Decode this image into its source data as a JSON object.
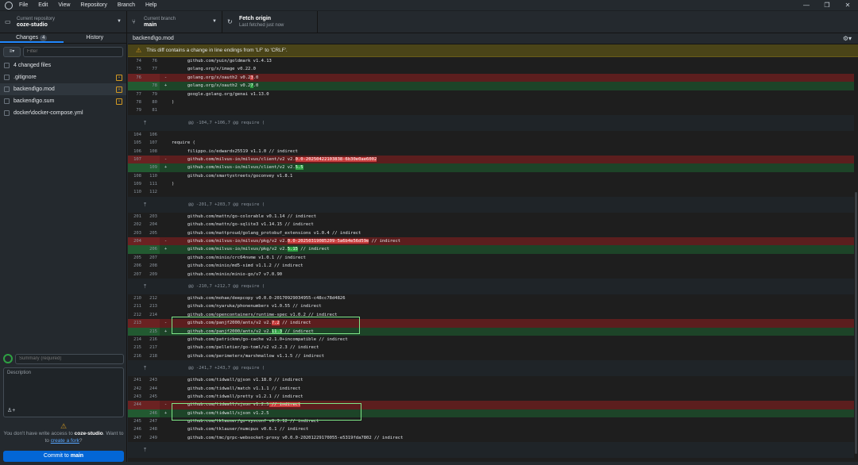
{
  "menu": [
    "File",
    "Edit",
    "View",
    "Repository",
    "Branch",
    "Help"
  ],
  "window_controls": [
    "—",
    "❐",
    "✕"
  ],
  "toolbar": {
    "repo": {
      "small": "Current repository",
      "name": "coze-studio"
    },
    "branch": {
      "small": "Current branch",
      "name": "main"
    },
    "fetch": {
      "title": "Fetch origin",
      "sub": "Last fetched just now"
    }
  },
  "sidebar": {
    "tab_changes": "Changes",
    "changes_count": "4",
    "tab_history": "History",
    "filter_placeholder": "Filter",
    "changed_files_label": "4 changed files",
    "files": [
      {
        "name": ".gitignore"
      },
      {
        "name": "backend\\go.mod"
      },
      {
        "name": "backend\\go.sum"
      },
      {
        "name": "docker\\docker-compose.yml"
      }
    ]
  },
  "commit": {
    "summary_placeholder": "Summary (required)",
    "description_placeholder": "Description",
    "warning_text": "You don't have write access to",
    "warning_repo": "coze-studio",
    "warning_tail": ". Want to",
    "warning_link": "create a fork",
    "warning_end": "?",
    "button": "Commit to",
    "button_branch": "main"
  },
  "diff": {
    "path": "backend\\go.mod",
    "banner": "This diff contains a change in line endings from 'LF' to 'CRLF'.",
    "lines": [
      {
        "t": "ctx",
        "a": "74",
        "b": "76",
        "c": "      github.com/yuin/goldmark v1.4.13"
      },
      {
        "t": "ctx",
        "a": "75",
        "b": "77",
        "c": "      golang.org/x/image v0.22.0"
      },
      {
        "t": "del",
        "a": "76",
        "b": "",
        "c": "      golang.org/x/oauth2 v0.2",
        "h": "3",
        "r": ".0"
      },
      {
        "t": "add",
        "a": "",
        "b": "78",
        "c": "      golang.org/x/oauth2 v0.2",
        "h": "7",
        "r": ".0"
      },
      {
        "t": "ctx",
        "a": "77",
        "b": "79",
        "c": "      google.golang.org/genai v1.13.0"
      },
      {
        "t": "ctx",
        "a": "78",
        "b": "80",
        "c": ")"
      },
      {
        "t": "ctx",
        "a": "79",
        "b": "81",
        "c": ""
      },
      {
        "t": "hunk",
        "c": "@@ -104,7 +106,7 @@ require ("
      },
      {
        "t": "ctx",
        "a": "104",
        "b": "106",
        "c": ""
      },
      {
        "t": "ctx",
        "a": "105",
        "b": "107",
        "c": "require ("
      },
      {
        "t": "ctx",
        "a": "106",
        "b": "108",
        "c": "      filippo.io/edwards25519 v1.1.0 // indirect"
      },
      {
        "t": "del",
        "a": "107",
        "b": "",
        "c": "      github.com/milvus-io/milvus/client/v2 v2.",
        "h": "0.0-20250422103838-6b30e0ae6002",
        "r": ""
      },
      {
        "t": "add",
        "a": "",
        "b": "109",
        "c": "      github.com/milvus-io/milvus/client/v2 v2.",
        "h": "5.5",
        "r": ""
      },
      {
        "t": "ctx",
        "a": "108",
        "b": "110",
        "c": "      github.com/smartystreets/goconvey v1.8.1"
      },
      {
        "t": "ctx",
        "a": "109",
        "b": "111",
        "c": ")"
      },
      {
        "t": "ctx",
        "a": "110",
        "b": "112",
        "c": ""
      },
      {
        "t": "hunk",
        "c": "@@ -201,7 +203,7 @@ require ("
      },
      {
        "t": "ctx",
        "a": "201",
        "b": "203",
        "c": "      github.com/mattn/go-colorable v0.1.14 // indirect"
      },
      {
        "t": "ctx",
        "a": "202",
        "b": "204",
        "c": "      github.com/mattn/go-sqlite3 v1.14.15 // indirect"
      },
      {
        "t": "ctx",
        "a": "203",
        "b": "205",
        "c": "      github.com/mattproud/golang_protobuf_extensions v1.0.4 // indirect"
      },
      {
        "t": "del",
        "a": "204",
        "b": "",
        "c": "      github.com/milvus-io/milvus/pkg/v2 v2.",
        "h": "0.0-20250319085209-5a6b4e56d59e",
        "r": " // indirect"
      },
      {
        "t": "add",
        "a": "",
        "b": "206",
        "c": "      github.com/milvus-io/milvus/pkg/v2 v2.",
        "h": "5.15",
        "r": " // indirect"
      },
      {
        "t": "ctx",
        "a": "205",
        "b": "207",
        "c": "      github.com/minio/crc64nvme v1.0.1 // indirect"
      },
      {
        "t": "ctx",
        "a": "206",
        "b": "208",
        "c": "      github.com/minio/md5-simd v1.1.2 // indirect"
      },
      {
        "t": "ctx",
        "a": "207",
        "b": "209",
        "c": "      github.com/minio/minio-go/v7 v7.0.90"
      },
      {
        "t": "hunk",
        "c": "@@ -210,7 +212,7 @@ require ("
      },
      {
        "t": "ctx",
        "a": "210",
        "b": "212",
        "c": "      github.com/mohae/deepcopy v0.0.0-20170929034955-c48cc78d4826"
      },
      {
        "t": "ctx",
        "a": "211",
        "b": "213",
        "c": "      github.com/nyaruka/phonenumbers v1.0.55 // indirect"
      },
      {
        "t": "ctx",
        "a": "212",
        "b": "214",
        "c": "      github.com/opencontainers/runtime-spec v1.0.2 // indirect"
      },
      {
        "t": "del",
        "a": "213",
        "b": "",
        "c": "      github.com/panjf2000/ants/v2 v2.",
        "h": "7.2",
        "r": " // indirect"
      },
      {
        "t": "add",
        "a": "",
        "b": "215",
        "c": "      github.com/panjf2000/ants/v2 v2.",
        "h": "11.3",
        "r": " // indirect"
      },
      {
        "t": "ctx",
        "a": "214",
        "b": "216",
        "c": "      github.com/patrickmn/go-cache v2.1.0+incompatible // indirect"
      },
      {
        "t": "ctx",
        "a": "215",
        "b": "217",
        "c": "      github.com/pelletier/go-toml/v2 v2.2.3 // indirect"
      },
      {
        "t": "ctx",
        "a": "216",
        "b": "218",
        "c": "      github.com/perimeterx/marshmallow v1.1.5 // indirect"
      },
      {
        "t": "hunk",
        "c": "@@ -241,7 +243,7 @@ require ("
      },
      {
        "t": "ctx",
        "a": "241",
        "b": "243",
        "c": "      github.com/tidwall/gjson v1.18.0 // indirect"
      },
      {
        "t": "ctx",
        "a": "242",
        "b": "244",
        "c": "      github.com/tidwall/match v1.1.1 // indirect"
      },
      {
        "t": "ctx",
        "a": "243",
        "b": "245",
        "c": "      github.com/tidwall/pretty v1.2.1 // indirect"
      },
      {
        "t": "del",
        "a": "244",
        "b": "",
        "c": "      github.com/tidwall/sjson v1.2.5",
        "h": " // indirect",
        "r": ""
      },
      {
        "t": "add",
        "a": "",
        "b": "246",
        "c": "      github.com/tidwall/sjson v1.2.5",
        "h": "",
        "r": ""
      },
      {
        "t": "ctx",
        "a": "245",
        "b": "247",
        "c": "      github.com/tklauser/go-sysconf v0.3.12 // indirect"
      },
      {
        "t": "ctx",
        "a": "246",
        "b": "248",
        "c": "      github.com/tklauser/numcpus v0.6.1 // indirect"
      },
      {
        "t": "ctx",
        "a": "247",
        "b": "249",
        "c": "      github.com/tmc/grpc-websocket-proxy v0.0.0-20201229170055-e5319fda7802 // indirect"
      },
      {
        "t": "hunk",
        "c": ""
      }
    ]
  }
}
